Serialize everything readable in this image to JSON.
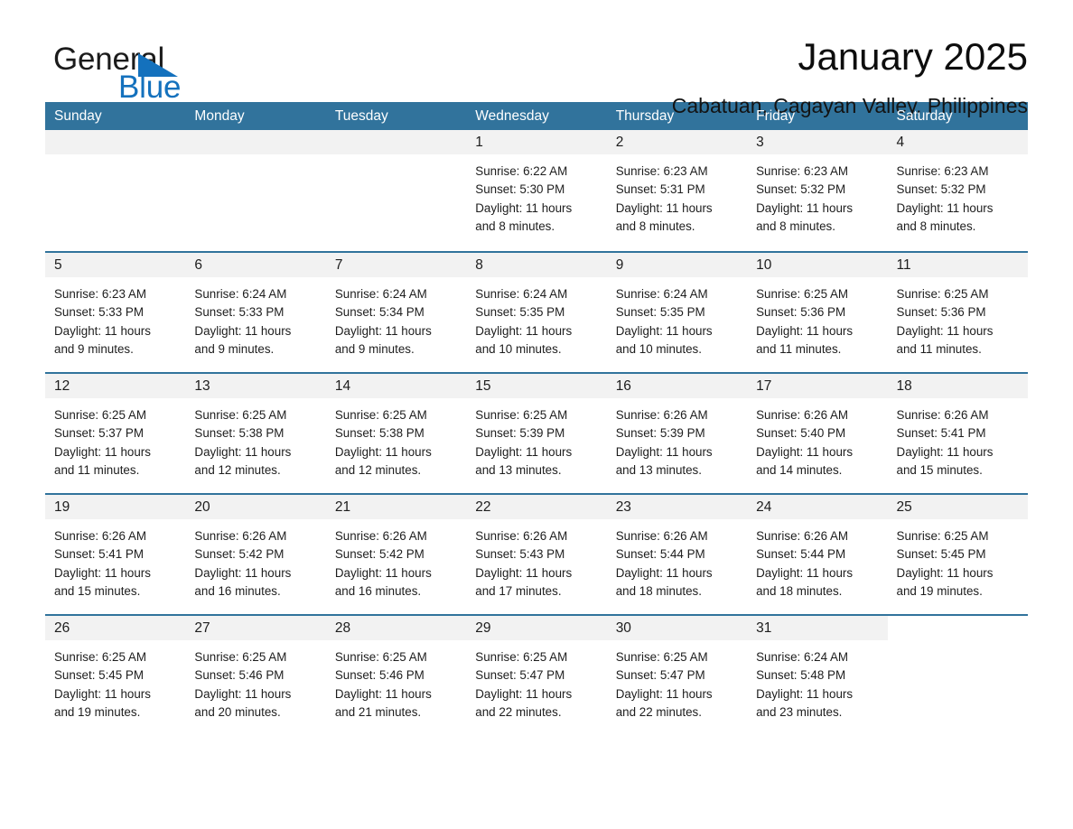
{
  "brand": {
    "name_part1": "General",
    "name_part2": "Blue",
    "accent_color": "#1471bd",
    "triangle_icon": "triangle-right-icon"
  },
  "header": {
    "month_title": "January 2025",
    "location": "Cabatuan, Cagayan Valley, Philippines"
  },
  "calendar": {
    "header_bg": "#31739c",
    "day_band_bg": "#f2f2f2",
    "weekdays": [
      "Sunday",
      "Monday",
      "Tuesday",
      "Wednesday",
      "Thursday",
      "Friday",
      "Saturday"
    ],
    "weeks": [
      [
        {
          "day": "",
          "sunrise": "",
          "sunset": "",
          "daylight_line1": "",
          "daylight_line2": "",
          "empty": true
        },
        {
          "day": "",
          "sunrise": "",
          "sunset": "",
          "daylight_line1": "",
          "daylight_line2": "",
          "empty": true
        },
        {
          "day": "",
          "sunrise": "",
          "sunset": "",
          "daylight_line1": "",
          "daylight_line2": "",
          "empty": true
        },
        {
          "day": "1",
          "sunrise": "Sunrise: 6:22 AM",
          "sunset": "Sunset: 5:30 PM",
          "daylight_line1": "Daylight: 11 hours",
          "daylight_line2": "and 8 minutes.",
          "empty": false
        },
        {
          "day": "2",
          "sunrise": "Sunrise: 6:23 AM",
          "sunset": "Sunset: 5:31 PM",
          "daylight_line1": "Daylight: 11 hours",
          "daylight_line2": "and 8 minutes.",
          "empty": false
        },
        {
          "day": "3",
          "sunrise": "Sunrise: 6:23 AM",
          "sunset": "Sunset: 5:32 PM",
          "daylight_line1": "Daylight: 11 hours",
          "daylight_line2": "and 8 minutes.",
          "empty": false
        },
        {
          "day": "4",
          "sunrise": "Sunrise: 6:23 AM",
          "sunset": "Sunset: 5:32 PM",
          "daylight_line1": "Daylight: 11 hours",
          "daylight_line2": "and 8 minutes.",
          "empty": false
        }
      ],
      [
        {
          "day": "5",
          "sunrise": "Sunrise: 6:23 AM",
          "sunset": "Sunset: 5:33 PM",
          "daylight_line1": "Daylight: 11 hours",
          "daylight_line2": "and 9 minutes.",
          "empty": false
        },
        {
          "day": "6",
          "sunrise": "Sunrise: 6:24 AM",
          "sunset": "Sunset: 5:33 PM",
          "daylight_line1": "Daylight: 11 hours",
          "daylight_line2": "and 9 minutes.",
          "empty": false
        },
        {
          "day": "7",
          "sunrise": "Sunrise: 6:24 AM",
          "sunset": "Sunset: 5:34 PM",
          "daylight_line1": "Daylight: 11 hours",
          "daylight_line2": "and 9 minutes.",
          "empty": false
        },
        {
          "day": "8",
          "sunrise": "Sunrise: 6:24 AM",
          "sunset": "Sunset: 5:35 PM",
          "daylight_line1": "Daylight: 11 hours",
          "daylight_line2": "and 10 minutes.",
          "empty": false
        },
        {
          "day": "9",
          "sunrise": "Sunrise: 6:24 AM",
          "sunset": "Sunset: 5:35 PM",
          "daylight_line1": "Daylight: 11 hours",
          "daylight_line2": "and 10 minutes.",
          "empty": false
        },
        {
          "day": "10",
          "sunrise": "Sunrise: 6:25 AM",
          "sunset": "Sunset: 5:36 PM",
          "daylight_line1": "Daylight: 11 hours",
          "daylight_line2": "and 11 minutes.",
          "empty": false
        },
        {
          "day": "11",
          "sunrise": "Sunrise: 6:25 AM",
          "sunset": "Sunset: 5:36 PM",
          "daylight_line1": "Daylight: 11 hours",
          "daylight_line2": "and 11 minutes.",
          "empty": false
        }
      ],
      [
        {
          "day": "12",
          "sunrise": "Sunrise: 6:25 AM",
          "sunset": "Sunset: 5:37 PM",
          "daylight_line1": "Daylight: 11 hours",
          "daylight_line2": "and 11 minutes.",
          "empty": false
        },
        {
          "day": "13",
          "sunrise": "Sunrise: 6:25 AM",
          "sunset": "Sunset: 5:38 PM",
          "daylight_line1": "Daylight: 11 hours",
          "daylight_line2": "and 12 minutes.",
          "empty": false
        },
        {
          "day": "14",
          "sunrise": "Sunrise: 6:25 AM",
          "sunset": "Sunset: 5:38 PM",
          "daylight_line1": "Daylight: 11 hours",
          "daylight_line2": "and 12 minutes.",
          "empty": false
        },
        {
          "day": "15",
          "sunrise": "Sunrise: 6:25 AM",
          "sunset": "Sunset: 5:39 PM",
          "daylight_line1": "Daylight: 11 hours",
          "daylight_line2": "and 13 minutes.",
          "empty": false
        },
        {
          "day": "16",
          "sunrise": "Sunrise: 6:26 AM",
          "sunset": "Sunset: 5:39 PM",
          "daylight_line1": "Daylight: 11 hours",
          "daylight_line2": "and 13 minutes.",
          "empty": false
        },
        {
          "day": "17",
          "sunrise": "Sunrise: 6:26 AM",
          "sunset": "Sunset: 5:40 PM",
          "daylight_line1": "Daylight: 11 hours",
          "daylight_line2": "and 14 minutes.",
          "empty": false
        },
        {
          "day": "18",
          "sunrise": "Sunrise: 6:26 AM",
          "sunset": "Sunset: 5:41 PM",
          "daylight_line1": "Daylight: 11 hours",
          "daylight_line2": "and 15 minutes.",
          "empty": false
        }
      ],
      [
        {
          "day": "19",
          "sunrise": "Sunrise: 6:26 AM",
          "sunset": "Sunset: 5:41 PM",
          "daylight_line1": "Daylight: 11 hours",
          "daylight_line2": "and 15 minutes.",
          "empty": false
        },
        {
          "day": "20",
          "sunrise": "Sunrise: 6:26 AM",
          "sunset": "Sunset: 5:42 PM",
          "daylight_line1": "Daylight: 11 hours",
          "daylight_line2": "and 16 minutes.",
          "empty": false
        },
        {
          "day": "21",
          "sunrise": "Sunrise: 6:26 AM",
          "sunset": "Sunset: 5:42 PM",
          "daylight_line1": "Daylight: 11 hours",
          "daylight_line2": "and 16 minutes.",
          "empty": false
        },
        {
          "day": "22",
          "sunrise": "Sunrise: 6:26 AM",
          "sunset": "Sunset: 5:43 PM",
          "daylight_line1": "Daylight: 11 hours",
          "daylight_line2": "and 17 minutes.",
          "empty": false
        },
        {
          "day": "23",
          "sunrise": "Sunrise: 6:26 AM",
          "sunset": "Sunset: 5:44 PM",
          "daylight_line1": "Daylight: 11 hours",
          "daylight_line2": "and 18 minutes.",
          "empty": false
        },
        {
          "day": "24",
          "sunrise": "Sunrise: 6:26 AM",
          "sunset": "Sunset: 5:44 PM",
          "daylight_line1": "Daylight: 11 hours",
          "daylight_line2": "and 18 minutes.",
          "empty": false
        },
        {
          "day": "25",
          "sunrise": "Sunrise: 6:25 AM",
          "sunset": "Sunset: 5:45 PM",
          "daylight_line1": "Daylight: 11 hours",
          "daylight_line2": "and 19 minutes.",
          "empty": false
        }
      ],
      [
        {
          "day": "26",
          "sunrise": "Sunrise: 6:25 AM",
          "sunset": "Sunset: 5:45 PM",
          "daylight_line1": "Daylight: 11 hours",
          "daylight_line2": "and 19 minutes.",
          "empty": false
        },
        {
          "day": "27",
          "sunrise": "Sunrise: 6:25 AM",
          "sunset": "Sunset: 5:46 PM",
          "daylight_line1": "Daylight: 11 hours",
          "daylight_line2": "and 20 minutes.",
          "empty": false
        },
        {
          "day": "28",
          "sunrise": "Sunrise: 6:25 AM",
          "sunset": "Sunset: 5:46 PM",
          "daylight_line1": "Daylight: 11 hours",
          "daylight_line2": "and 21 minutes.",
          "empty": false
        },
        {
          "day": "29",
          "sunrise": "Sunrise: 6:25 AM",
          "sunset": "Sunset: 5:47 PM",
          "daylight_line1": "Daylight: 11 hours",
          "daylight_line2": "and 22 minutes.",
          "empty": false
        },
        {
          "day": "30",
          "sunrise": "Sunrise: 6:25 AM",
          "sunset": "Sunset: 5:47 PM",
          "daylight_line1": "Daylight: 11 hours",
          "daylight_line2": "and 22 minutes.",
          "empty": false
        },
        {
          "day": "31",
          "sunrise": "Sunrise: 6:24 AM",
          "sunset": "Sunset: 5:48 PM",
          "daylight_line1": "Daylight: 11 hours",
          "daylight_line2": "and 23 minutes.",
          "empty": false
        },
        {
          "day": "",
          "sunrise": "",
          "sunset": "",
          "daylight_line1": "",
          "daylight_line2": "",
          "empty": true
        }
      ]
    ]
  }
}
